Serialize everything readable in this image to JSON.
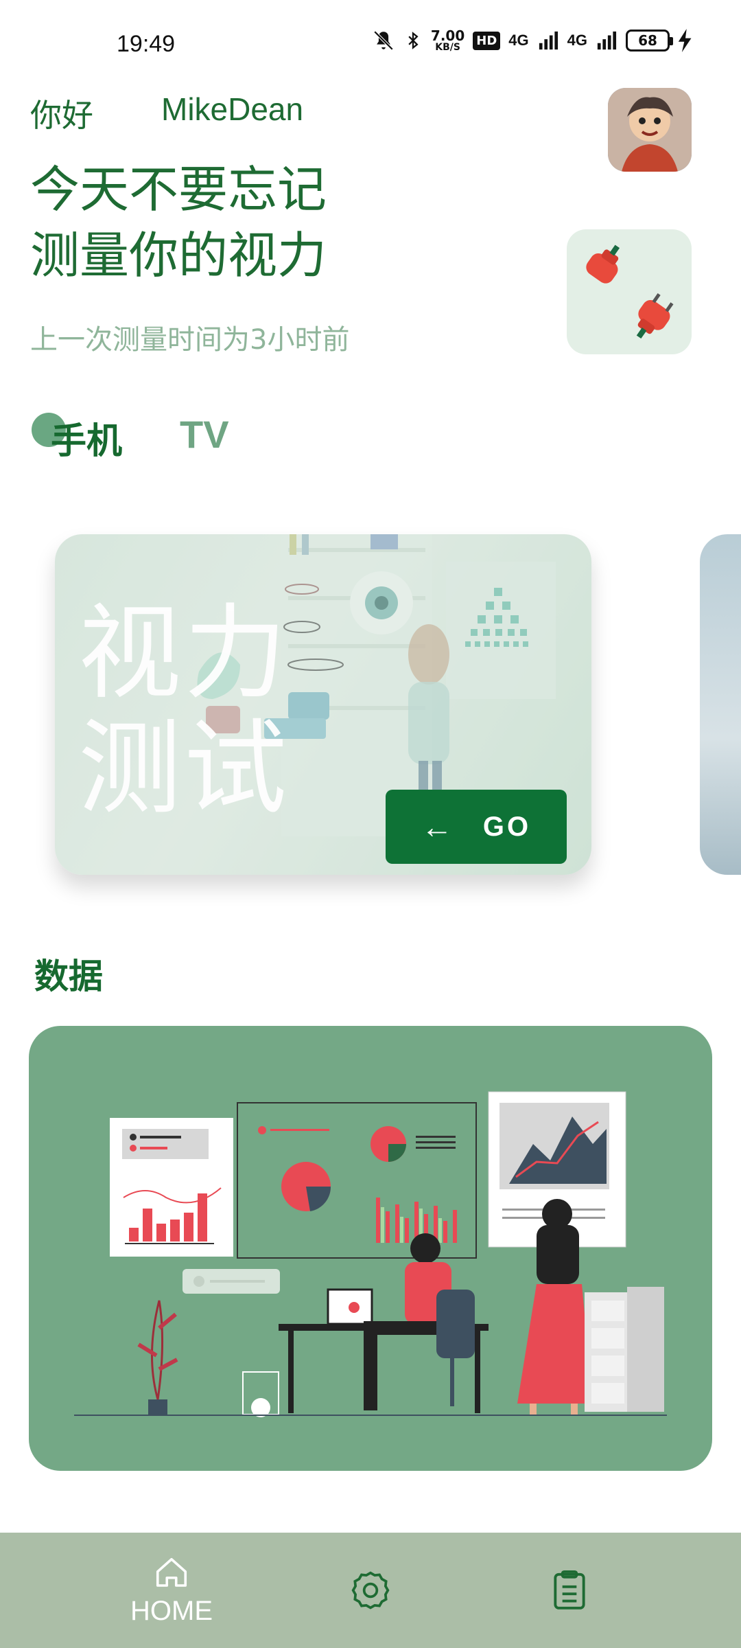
{
  "status_bar": {
    "time": "19:49",
    "speed_value": "7.00",
    "speed_unit": "KB/S",
    "hd_badge": "HD",
    "network1": "4G",
    "network2": "4G",
    "battery": "68",
    "icons": [
      "bell-off-icon",
      "bluetooth-icon",
      "signal-icon",
      "charging-icon"
    ]
  },
  "header": {
    "greeting": "你好",
    "username": "MikeDean",
    "headline_line1": "今天不要忘记",
    "headline_line2": "测量你的视力",
    "last_measure": "上一次测量时间为3小时前"
  },
  "tabs": {
    "items": [
      {
        "label": "手机",
        "selected": true
      },
      {
        "label": "TV",
        "selected": false
      }
    ]
  },
  "test_card": {
    "title_line1": "视力",
    "title_line2": "测试",
    "go_label": "GO"
  },
  "data_section": {
    "title": "数据"
  },
  "bottom_nav": {
    "home_label": "HOME",
    "items": [
      "home-icon",
      "settings-icon",
      "records-icon"
    ]
  },
  "colors": {
    "primary": "#16692f",
    "accent_green": "#74a886",
    "go_button": "#0e7236",
    "nav_bg": "#abbea7"
  }
}
